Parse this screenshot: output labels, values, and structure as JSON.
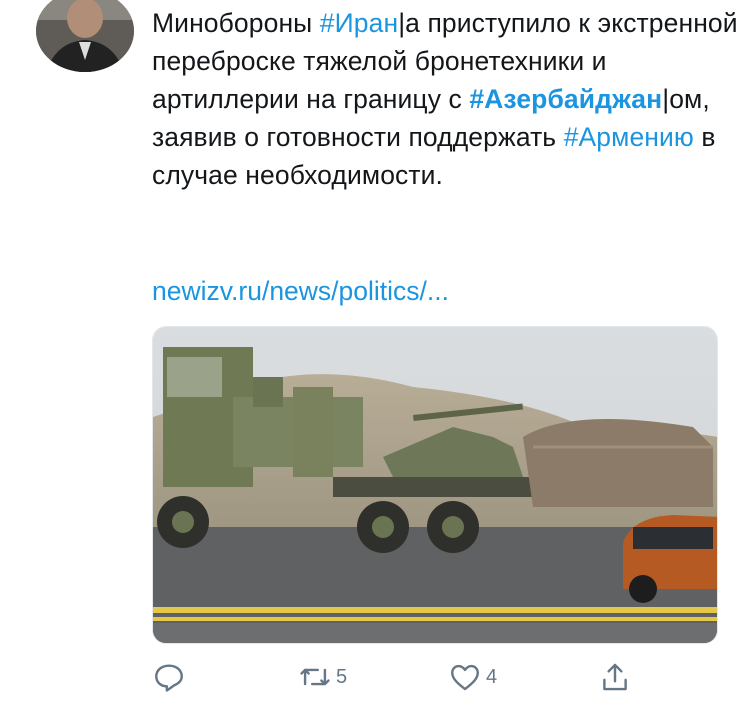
{
  "tweet": {
    "text_parts": [
      {
        "text": "Минобороны ",
        "type": "plain"
      },
      {
        "text": "#Иран",
        "type": "tag"
      },
      {
        "text": "|а приступило к экстренной переброске тяжелой бронетехники и артиллерии на границу с ",
        "type": "plain"
      },
      {
        "text": "#Азербайджан",
        "type": "tag-bold"
      },
      {
        "text": "|ом, заявив о готовности поддержать ",
        "type": "plain"
      },
      {
        "text": "#Армению",
        "type": "tag"
      },
      {
        "text": " в случае необходимости.",
        "type": "plain"
      }
    ],
    "link": "newizv.ru/news/politics/...",
    "image_description_icon": "military-truck-photo"
  },
  "actions": {
    "reply": {
      "icon": "reply-icon",
      "count": ""
    },
    "retweet": {
      "icon": "retweet-icon",
      "count": "5"
    },
    "like": {
      "icon": "heart-icon",
      "count": "4"
    },
    "share": {
      "icon": "share-icon",
      "count": ""
    }
  },
  "colors": {
    "accent": "#1b95e0",
    "text": "#14171a",
    "muted": "#657786"
  }
}
